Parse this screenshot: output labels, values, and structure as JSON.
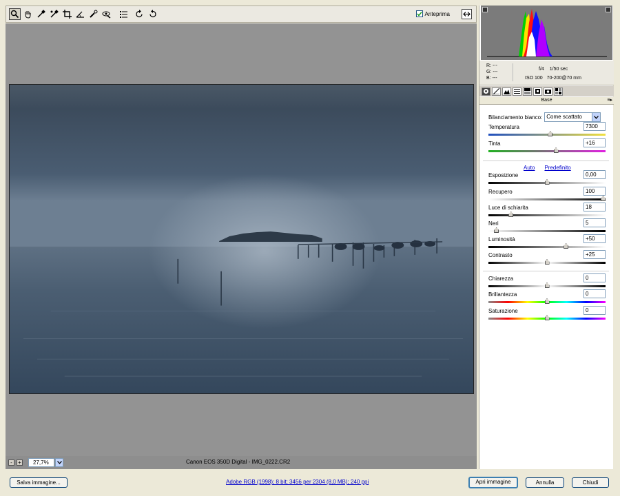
{
  "toolbar": {
    "tools": [
      "zoom-icon",
      "hand-icon",
      "white-balance-icon",
      "color-sampler-icon",
      "crop-icon",
      "straighten-icon",
      "retouch-icon",
      "red-eye-icon",
      "preferences-icon",
      "rotate-left-icon",
      "rotate-right-icon"
    ],
    "preview_label": "Anteprima",
    "preview_checked": true
  },
  "status": {
    "zoom_value": "27,7%",
    "zoom_out": "-",
    "zoom_in": "+",
    "file_info": "Canon EOS 350D Digital  -  IMG_0222.CR2"
  },
  "info": {
    "r_label": "R:",
    "r_value": "---",
    "g_label": "G:",
    "g_value": "---",
    "b_label": "B:",
    "b_value": "---",
    "aperture": "f/4",
    "shutter": "1/50 sec",
    "iso": "ISO 100",
    "lens": "70-200@70 mm"
  },
  "panel": {
    "section_title": "Base",
    "white_balance_label": "Bilanciamento bianco:",
    "white_balance_value": "Come scattato",
    "auto_link": "Auto",
    "default_link": "Predefinito",
    "sliders": [
      {
        "label": "Temperatura",
        "value": "7300",
        "level": 0.53
      },
      {
        "label": "Tinta",
        "value": "+16",
        "level": 0.58
      },
      {
        "label": "Esposizione",
        "value": "0,00",
        "level": 0.5
      },
      {
        "label": "Recupero",
        "value": "100",
        "level": 1.0
      },
      {
        "label": "Luce di schiarita",
        "value": "18",
        "level": 0.18
      },
      {
        "label": "Neri",
        "value": "5",
        "level": 0.05
      },
      {
        "label": "Luminosità",
        "value": "+50",
        "level": 0.67
      },
      {
        "label": "Contrasto",
        "value": "+25",
        "level": 0.5
      },
      {
        "label": "Chiarezza",
        "value": "0",
        "level": 0.5
      },
      {
        "label": "Brillantezza",
        "value": "0",
        "level": 0.5
      },
      {
        "label": "Saturazione",
        "value": "0",
        "level": 0.5
      }
    ]
  },
  "footer": {
    "save_label": "Salva immagine...",
    "workflow_link": "Adobe RGB (1998); 8 bit; 3456 per 2304 (8,0 MB); 240 ppi",
    "open_label": "Apri immagine",
    "cancel_label": "Annulla",
    "close_label": "Chiudi"
  }
}
